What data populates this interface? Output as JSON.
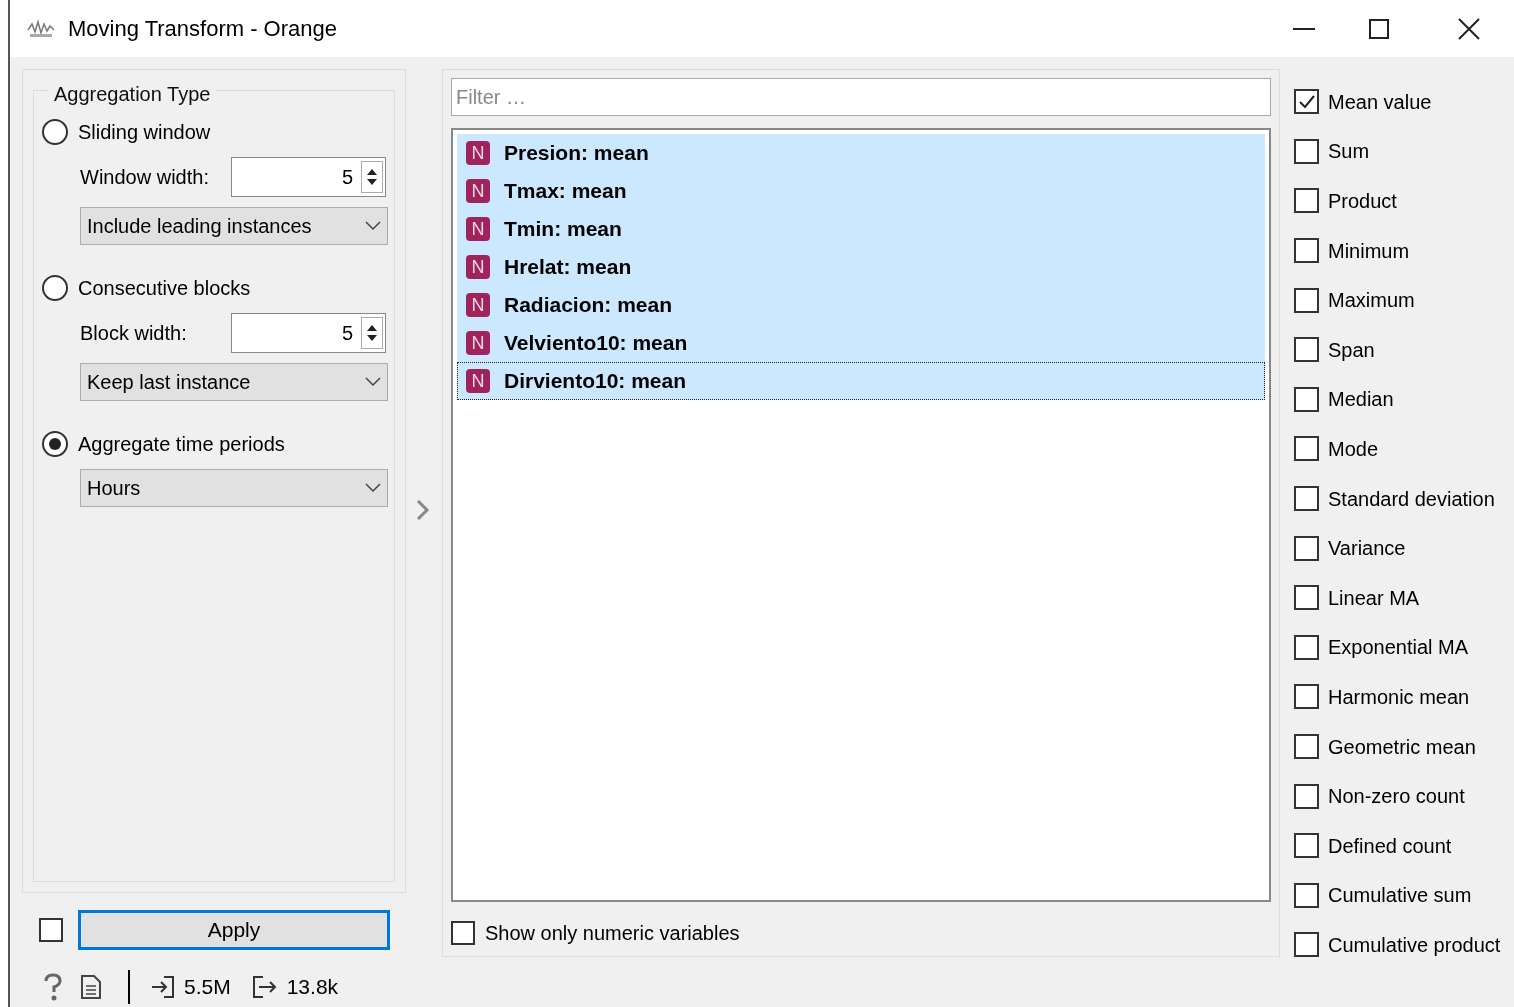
{
  "window": {
    "title": "Moving Transform - Orange"
  },
  "aggregation": {
    "title": "Aggregation Type",
    "options": [
      {
        "label": "Sliding window",
        "selected": false,
        "spin_label": "Window width:",
        "spin_value": "5",
        "dropdown": "Include leading instances"
      },
      {
        "label": "Consecutive blocks",
        "selected": false,
        "spin_label": "Block width:",
        "spin_value": "5",
        "dropdown": "Keep last instance"
      },
      {
        "label": "Aggregate time periods",
        "selected": true,
        "dropdown": "Hours"
      }
    ]
  },
  "auto_apply": {
    "checked": false
  },
  "apply_button": "Apply",
  "status_bar": {
    "input": "5.5M",
    "output": "13.8k"
  },
  "filter": {
    "placeholder": "Filter …"
  },
  "variables": [
    {
      "badge": "N",
      "label": "Presion: mean",
      "selected": true,
      "focused": false
    },
    {
      "badge": "N",
      "label": "Tmax: mean",
      "selected": true,
      "focused": false
    },
    {
      "badge": "N",
      "label": "Tmin: mean",
      "selected": true,
      "focused": false
    },
    {
      "badge": "N",
      "label": "Hrelat: mean",
      "selected": true,
      "focused": false
    },
    {
      "badge": "N",
      "label": "Radiacion: mean",
      "selected": true,
      "focused": false
    },
    {
      "badge": "N",
      "label": "Velviento10: mean",
      "selected": true,
      "focused": false
    },
    {
      "badge": "N",
      "label": "Dirviento10: mean",
      "selected": true,
      "focused": true
    }
  ],
  "show_numeric": {
    "label": "Show only numeric variables",
    "checked": false
  },
  "aggregations": [
    {
      "label": "Mean value",
      "checked": true
    },
    {
      "label": "Sum",
      "checked": false
    },
    {
      "label": "Product",
      "checked": false
    },
    {
      "label": "Minimum",
      "checked": false
    },
    {
      "label": "Maximum",
      "checked": false
    },
    {
      "label": "Span",
      "checked": false
    },
    {
      "label": "Median",
      "checked": false
    },
    {
      "label": "Mode",
      "checked": false
    },
    {
      "label": "Standard deviation",
      "checked": false
    },
    {
      "label": "Variance",
      "checked": false
    },
    {
      "label": "Linear MA",
      "checked": false
    },
    {
      "label": "Exponential MA",
      "checked": false
    },
    {
      "label": "Harmonic mean",
      "checked": false
    },
    {
      "label": "Geometric mean",
      "checked": false
    },
    {
      "label": "Non-zero count",
      "checked": false
    },
    {
      "label": "Defined count",
      "checked": false
    },
    {
      "label": "Cumulative sum",
      "checked": false
    },
    {
      "label": "Cumulative product",
      "checked": false
    }
  ]
}
